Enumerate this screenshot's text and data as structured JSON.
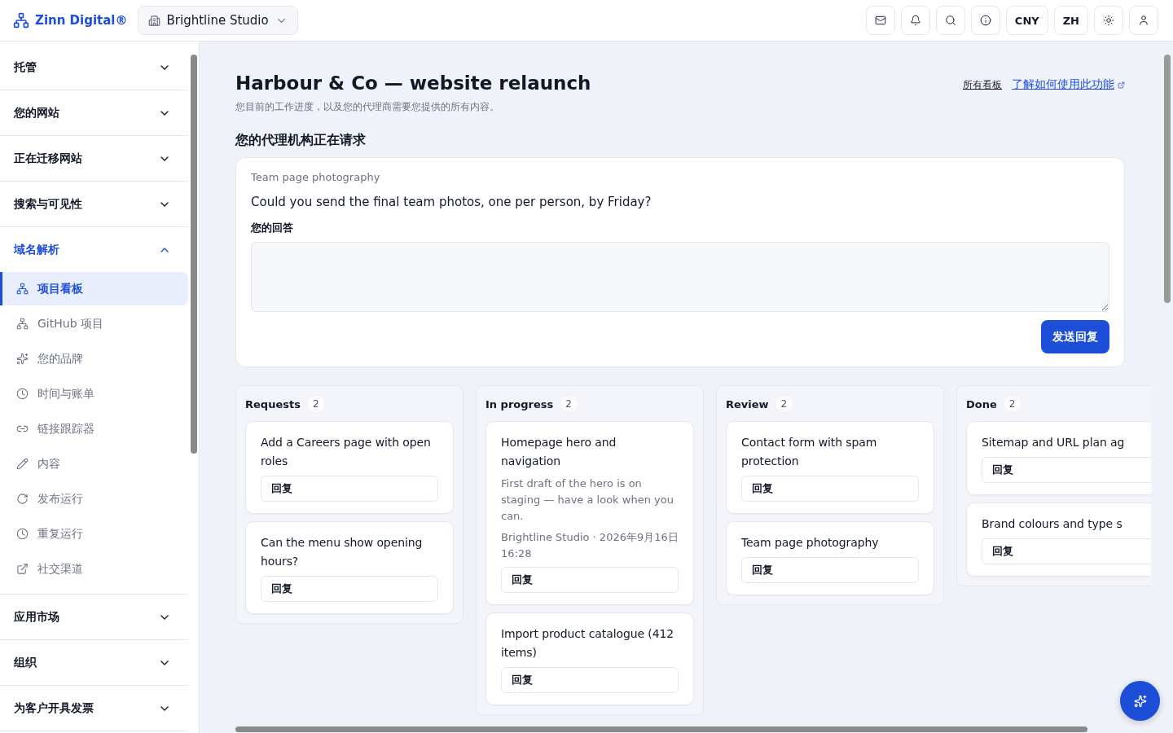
{
  "header": {
    "brand": "Zinn Digital®",
    "workspace": "Brightline Studio",
    "actions": [
      {
        "kind": "icon"
      },
      {
        "kind": "icon"
      },
      {
        "kind": "icon"
      },
      {
        "kind": "icon"
      },
      {
        "kind": "text",
        "label": "CNY"
      },
      {
        "kind": "text",
        "label": "ZH"
      },
      {
        "kind": "icon"
      },
      {
        "kind": "icon"
      }
    ]
  },
  "sidebar": {
    "sections": [
      {
        "label": "托管",
        "expanded": false
      },
      {
        "label": "您的网站",
        "expanded": false
      },
      {
        "label": "正在迁移网站",
        "expanded": false
      },
      {
        "label": "搜索与可见性",
        "expanded": false
      },
      {
        "label": "域名解析",
        "expanded": true,
        "children": [
          {
            "label": "项目看板",
            "selected": true
          },
          {
            "label": "GitHub 项目",
            "selected": false
          },
          {
            "label": "您的品牌",
            "selected": false
          },
          {
            "label": "时间与账单",
            "selected": false
          },
          {
            "label": "链接跟踪器",
            "selected": false
          },
          {
            "label": "内容",
            "selected": false
          },
          {
            "label": "发布运行",
            "selected": false
          },
          {
            "label": "重复运行",
            "selected": false
          },
          {
            "label": "社交渠道",
            "selected": false
          }
        ]
      },
      {
        "label": "应用市场",
        "expanded": false
      },
      {
        "label": "组织",
        "expanded": false
      },
      {
        "label": "为客户开具发票",
        "expanded": false
      }
    ]
  },
  "page": {
    "title": "Harbour & Co — website relaunch",
    "subtitle": "您目前的工作进度，以及您的代理商需要您提供的所有内容。",
    "links": [
      "所有看板",
      "了解如何使用此功能"
    ]
  },
  "request": {
    "heading": "您的代理机构正在请求",
    "topic": "Team page photography",
    "question": "Could you send the final team photos, one per person, by Friday?",
    "answer_label": "您的回答",
    "submit": "发送回复"
  },
  "board": {
    "columns": [
      {
        "title": "Requests",
        "count": "2",
        "cards": [
          {
            "title": "Add a Careers page with open roles",
            "reply": "回复"
          },
          {
            "title": "Can the menu show opening hours?",
            "reply": "回复"
          }
        ]
      },
      {
        "title": "In progress",
        "count": "2",
        "cards": [
          {
            "title": "Homepage hero and navigation",
            "note": "First draft of the hero is on staging — have a look when you can.",
            "meta": "Brightline Studio · 2026年9月16日 16:28",
            "reply": "回复"
          },
          {
            "title": "Import product catalogue (412 items)",
            "reply": "回复"
          }
        ]
      },
      {
        "title": "Review",
        "count": "2",
        "cards": [
          {
            "title": "Contact form with spam protection",
            "reply": "回复"
          },
          {
            "title": "Team page photography",
            "reply": "回复"
          }
        ]
      },
      {
        "title": "Done",
        "count": "2",
        "cards": [
          {
            "title": "Sitemap and URL plan ag",
            "reply": "回复"
          },
          {
            "title": "Brand colours and type s",
            "reply": "回复"
          }
        ]
      }
    ]
  }
}
